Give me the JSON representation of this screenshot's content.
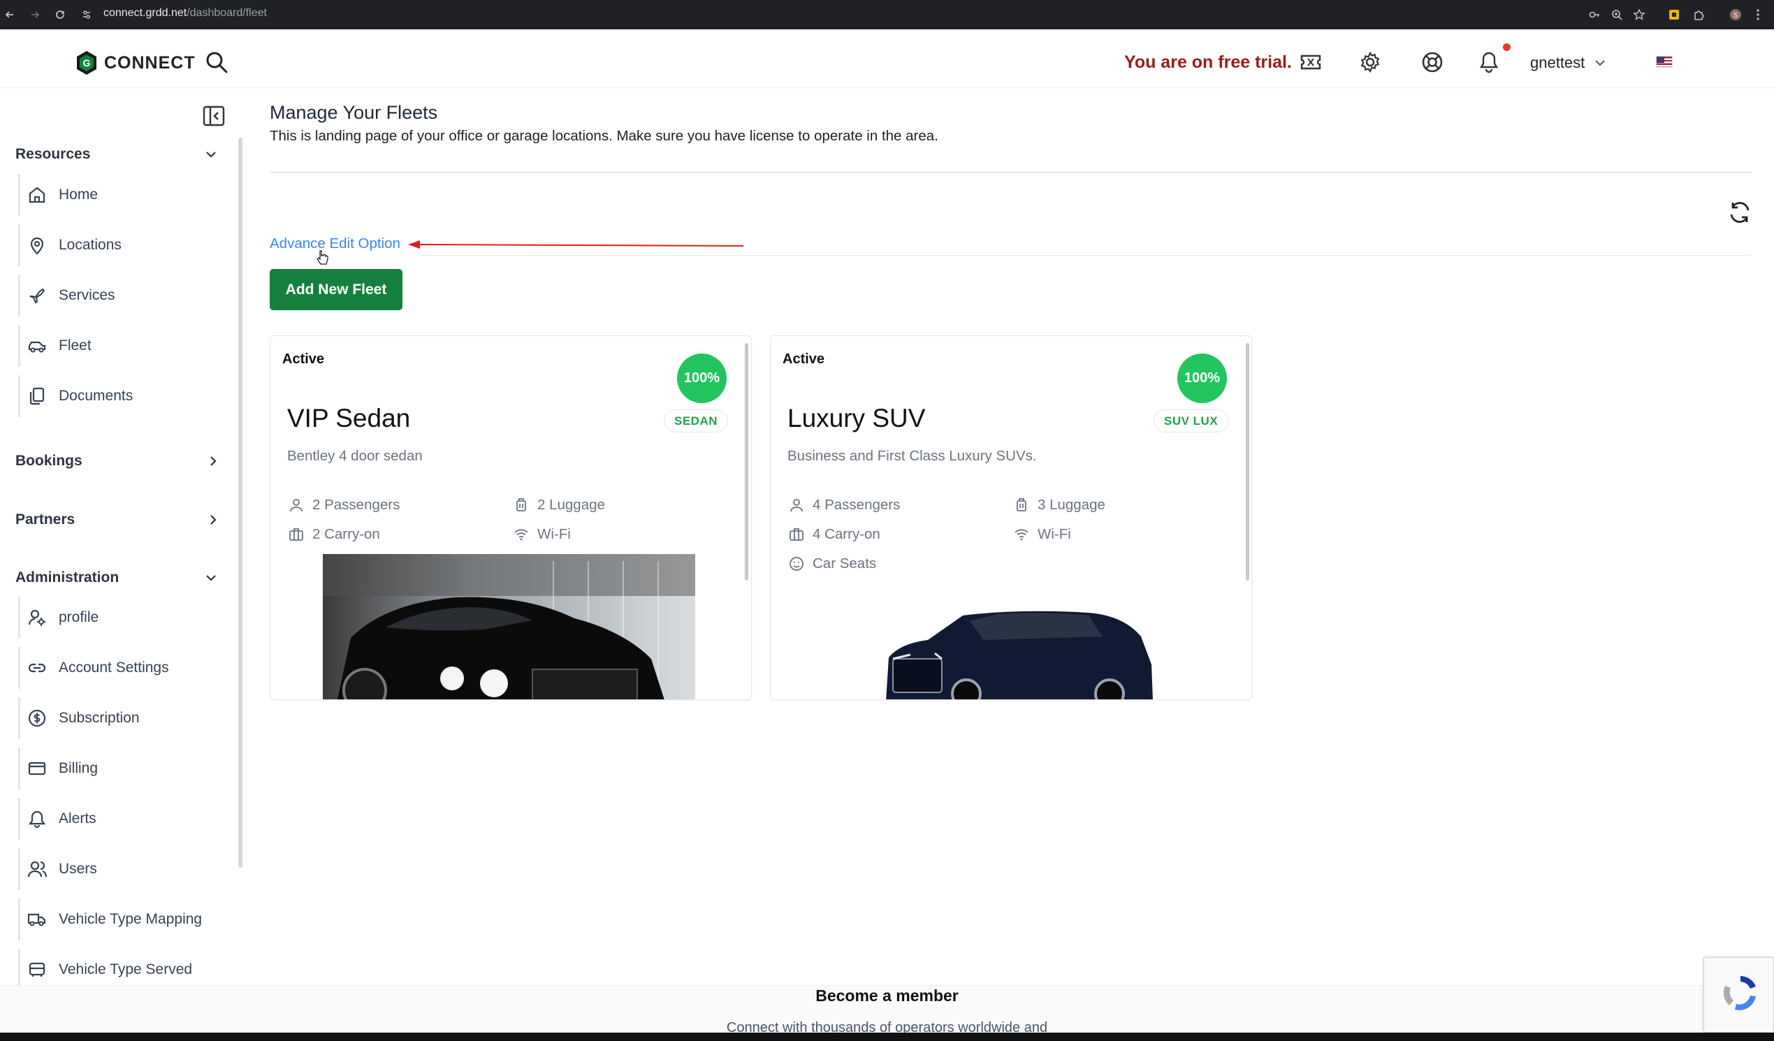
{
  "browser": {
    "url_host": "connect.grdd.net",
    "url_path": "/dashboard/fleet"
  },
  "header": {
    "logo_text": "CONNECT",
    "trial_text": "You are on free trial.",
    "username": "gnettest",
    "brand_color": "#15803d",
    "trial_color": "#9b1c1c"
  },
  "sidebar": {
    "sections": [
      {
        "label": "Resources",
        "expanded": true
      },
      {
        "label": "Bookings",
        "expanded": false
      },
      {
        "label": "Partners",
        "expanded": false
      },
      {
        "label": "Administration",
        "expanded": true
      }
    ],
    "resources_items": [
      {
        "label": "Home",
        "icon": "home-icon"
      },
      {
        "label": "Locations",
        "icon": "map-pin-icon"
      },
      {
        "label": "Services",
        "icon": "plane-icon"
      },
      {
        "label": "Fleet",
        "icon": "car-icon"
      },
      {
        "label": "Documents",
        "icon": "documents-icon"
      }
    ],
    "admin_items": [
      {
        "label": "profile",
        "icon": "user-gear-icon"
      },
      {
        "label": "Account Settings",
        "icon": "link-icon"
      },
      {
        "label": "Subscription",
        "icon": "dollar-circle-icon"
      },
      {
        "label": "Billing",
        "icon": "credit-card-icon"
      },
      {
        "label": "Alerts",
        "icon": "bell-icon"
      },
      {
        "label": "Users",
        "icon": "users-icon"
      },
      {
        "label": "Vehicle Type Mapping",
        "icon": "truck-icon"
      },
      {
        "label": "Vehicle Type Served",
        "icon": "bus-icon"
      }
    ]
  },
  "main": {
    "title": "Manage Your Fleets",
    "subtitle": "This is landing page of your office or garage locations. Make sure you have license to operate in the area.",
    "advance_edit_label": "Advance Edit Option",
    "add_fleet_label": "Add New Fleet"
  },
  "fleets": [
    {
      "status": "Active",
      "completion": "100%",
      "name": "VIP Sedan",
      "type": "SEDAN",
      "description": "Bentley 4 door sedan",
      "features": [
        "2 Passengers",
        "2 Luggage",
        "2 Carry-on",
        "Wi-Fi"
      ]
    },
    {
      "status": "Active",
      "completion": "100%",
      "name": "Luxury SUV",
      "type": "SUV LUX",
      "description": "Business and First Class Luxury SUVs.",
      "features": [
        "4 Passengers",
        "3 Luggage",
        "4 Carry-on",
        "Wi-Fi",
        "Car Seats"
      ]
    }
  ],
  "footer": {
    "title": "Become a member",
    "subtitle": "Connect with thousands of operators worldwide and"
  }
}
